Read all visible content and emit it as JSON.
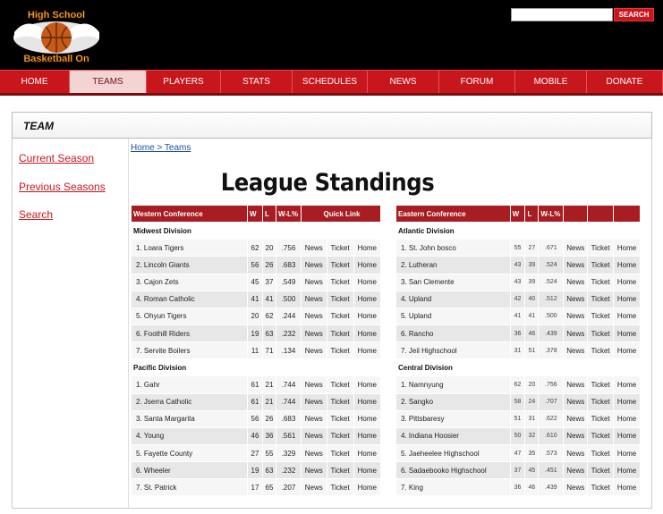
{
  "logo": {
    "line1": "High School",
    "line2": "Basketball On"
  },
  "search": {
    "placeholder": "",
    "button_label": "SEARCH"
  },
  "nav": [
    "HOME",
    "TEAMS",
    "PLAYERS",
    "STATS",
    "SCHEDULES",
    "NEWS",
    "FORUM",
    "MOBILE",
    "DONATE"
  ],
  "active_nav": "TEAMS",
  "team_bar_title": "TEAM",
  "sidebar": [
    "Current Season",
    "Previous Seasons",
    "Search"
  ],
  "breadcrumb": {
    "home": "Home",
    "sep": " > ",
    "current": "Teams"
  },
  "heading": "League Standings",
  "west": {
    "headers": [
      "Western Conference",
      "W",
      "L",
      "W-L%",
      "Quick Link"
    ],
    "divisions": [
      {
        "name": "Midwest Division",
        "teams": [
          {
            "team": "1.  Loara Tigers",
            "w": "62",
            "l": "20",
            "pct": ".756"
          },
          {
            "team": "2. Lincoln  Giants",
            "w": "56",
            "l": "26",
            "pct": ".683"
          },
          {
            "team": "3. Cajon  Zets",
            "w": "45",
            "l": "37",
            "pct": ".549"
          },
          {
            "team": "4.  Roman  Catholic",
            "w": "41",
            "l": "41",
            "pct": ".500"
          },
          {
            "team": "5. Ohyun Tigers",
            "w": "20",
            "l": "62",
            "pct": ".244"
          },
          {
            "team": "6. Foothill  Riders",
            "w": "19",
            "l": "63",
            "pct": ".232"
          },
          {
            "team": "7. Servite Boilers",
            "w": "11",
            "l": "71",
            "pct": ".134"
          }
        ]
      },
      {
        "name": "Pacific Division",
        "teams": [
          {
            "team": "1. Gahr",
            "w": "61",
            "l": "21",
            "pct": ".744"
          },
          {
            "team": "2. Jserra Catholic",
            "w": "61",
            "l": "21",
            "pct": ".744"
          },
          {
            "team": "3. Santa  Margarita",
            "w": "56",
            "l": "26",
            "pct": ".683"
          },
          {
            "team": "4. Young",
            "w": "46",
            "l": "36",
            "pct": ".561"
          },
          {
            "team": "5. Fayette County",
            "w": "27",
            "l": "55",
            "pct": ".329"
          },
          {
            "team": "6. Wheeler",
            "w": "19",
            "l": "63",
            "pct": ".232"
          },
          {
            "team": "7. St. Patrick",
            "w": "17",
            "l": "65",
            "pct": ".207"
          }
        ]
      }
    ]
  },
  "east": {
    "headers": [
      "Eastern Conference",
      "W",
      "L",
      "W-L%"
    ],
    "divisions": [
      {
        "name": "Atlantic Division",
        "teams": [
          {
            "team": "1. St. John bosco",
            "w": "55",
            "l": "27",
            "pct": ".671"
          },
          {
            "team": "2. Lutheran",
            "w": "43",
            "l": "39",
            "pct": ".524"
          },
          {
            "team": "3. San Clemente",
            "w": "43",
            "l": "39",
            "pct": ".524"
          },
          {
            "team": "4. Upland",
            "w": "42",
            "l": "40",
            "pct": ".512"
          },
          {
            "team": "5. Upland",
            "w": "41",
            "l": "41",
            "pct": ".500"
          },
          {
            "team": "6. Rancho",
            "w": "36",
            "l": "46",
            "pct": ".439"
          },
          {
            "team": "7. Jeil Highschool",
            "w": "31",
            "l": "51",
            "pct": ".378"
          }
        ]
      },
      {
        "name": "Central Division",
        "teams": [
          {
            "team": "1. Namnyung",
            "w": "62",
            "l": "20",
            "pct": ".756"
          },
          {
            "team": "2. Sangko",
            "w": "58",
            "l": "24",
            "pct": ".707"
          },
          {
            "team": "3. Pittsbaresy",
            "w": "51",
            "l": "31",
            "pct": ".622"
          },
          {
            "team": "4. Indiana  Hoosier",
            "w": "50",
            "l": "32",
            "pct": ".610"
          },
          {
            "team": "5. Jaeheelee  Highschool",
            "w": "47",
            "l": "35",
            "pct": ".573"
          },
          {
            "team": "6. Sadaebooko  Highschool",
            "w": "37",
            "l": "45",
            "pct": ".451"
          },
          {
            "team": "7. King",
            "w": "36",
            "l": "46",
            "pct": ".439"
          }
        ]
      }
    ]
  },
  "quick_links": [
    "News",
    "Ticket",
    "Home"
  ],
  "colors": {
    "brand_red": "#c8161d",
    "header_red": "#a71d22",
    "link_blue": "#1a4f9c"
  }
}
